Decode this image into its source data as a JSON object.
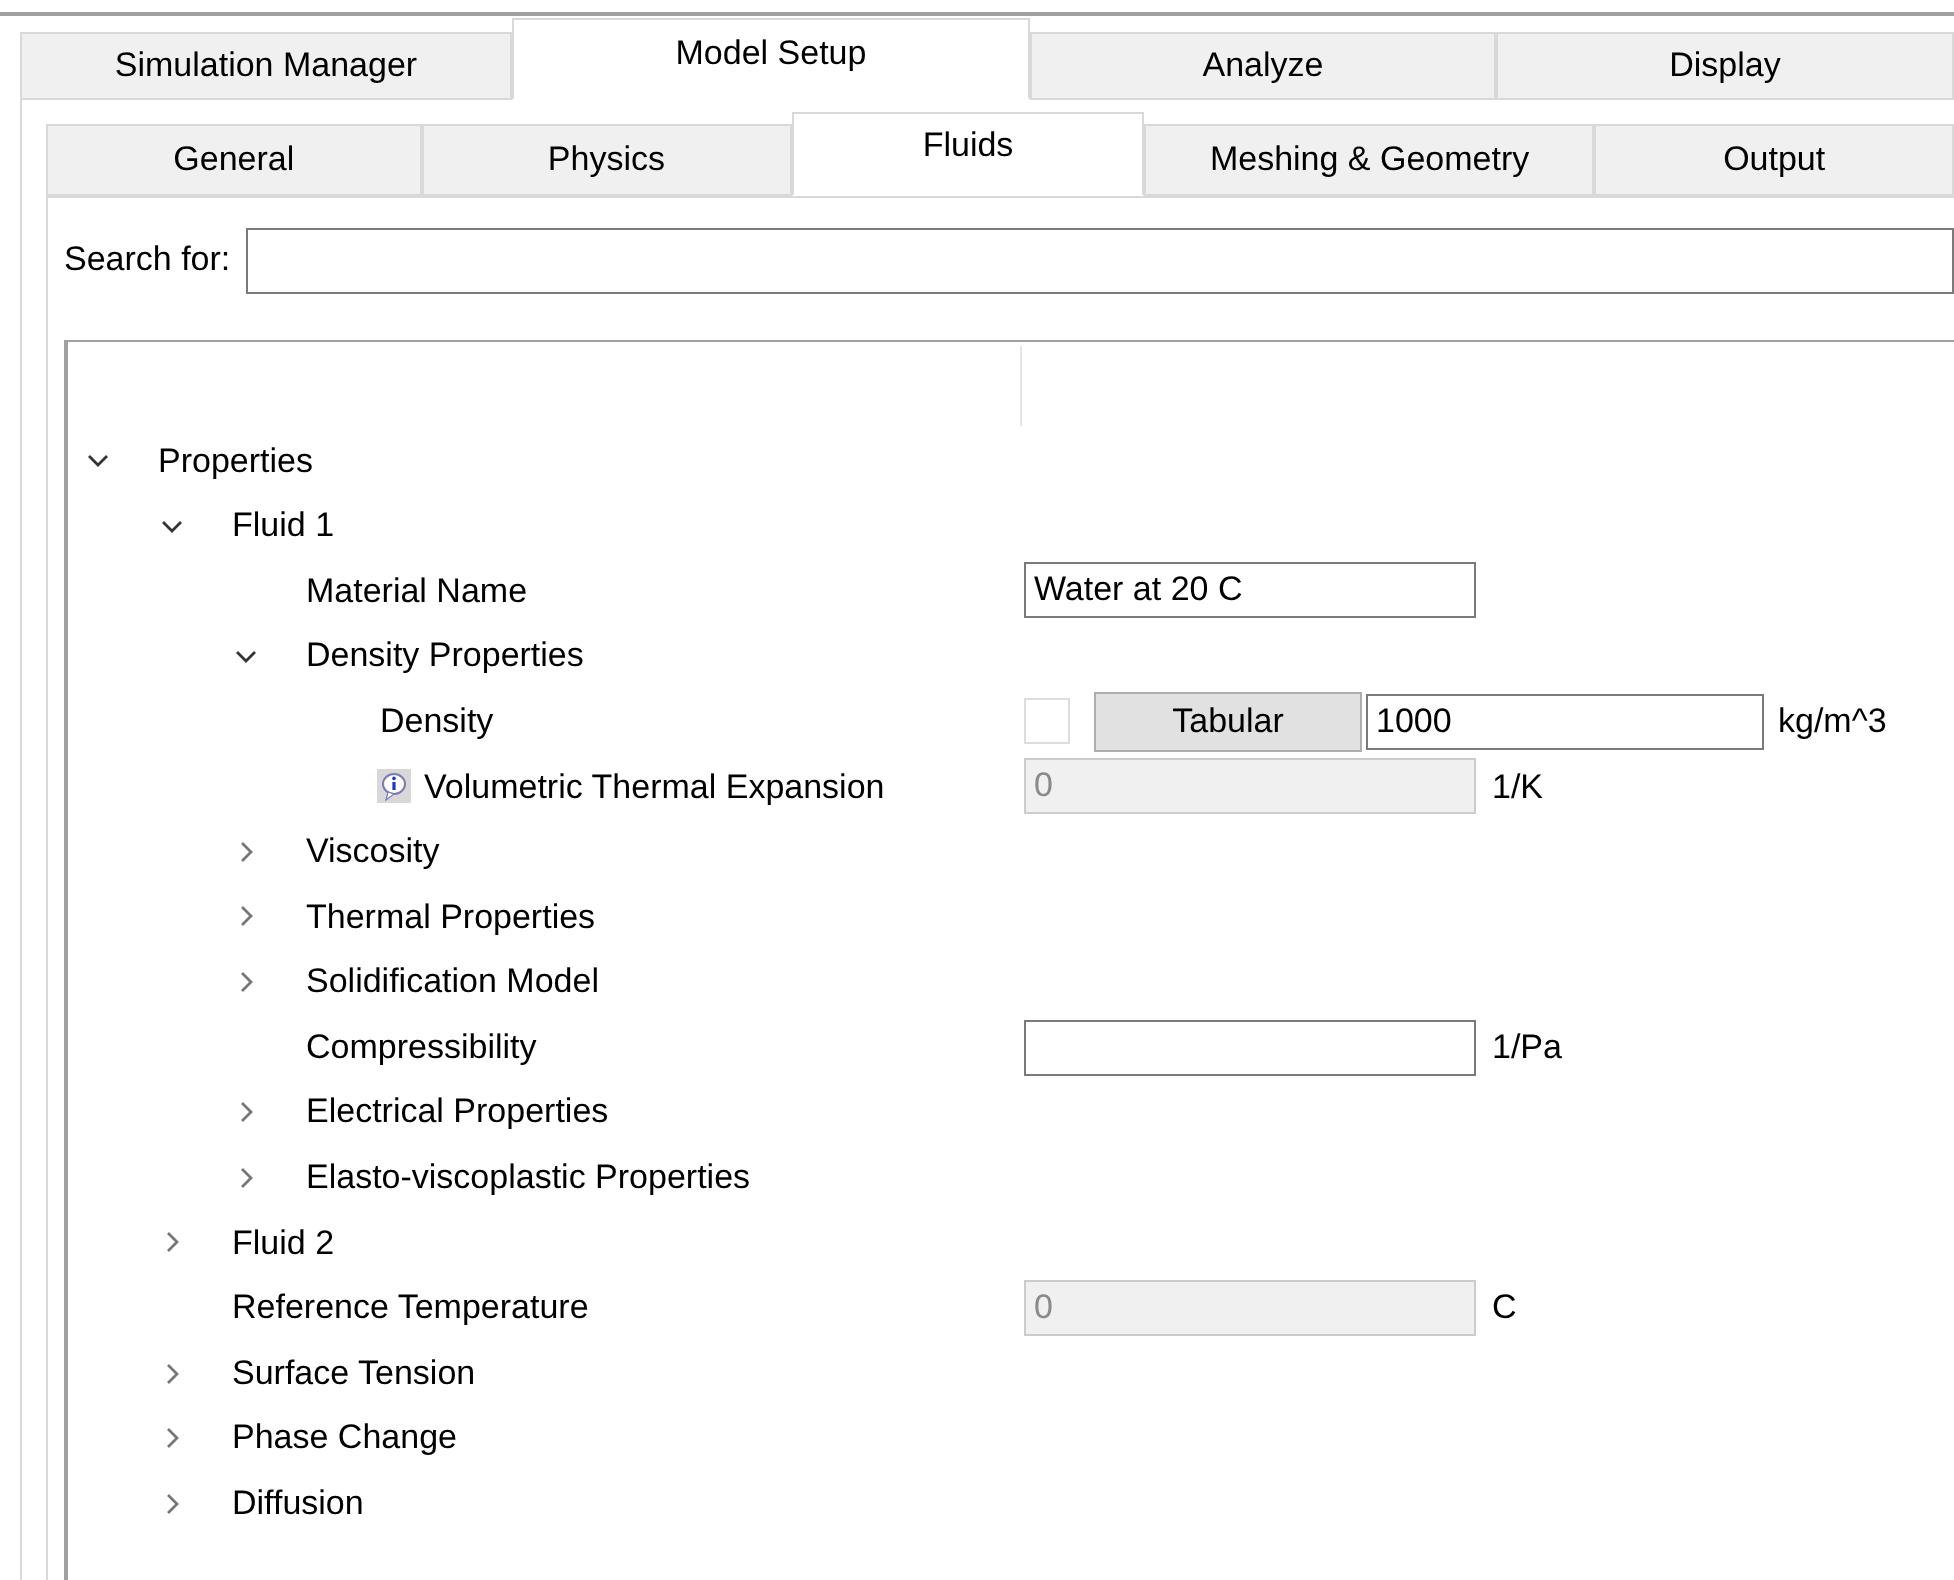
{
  "main_tabs": [
    {
      "label": "Simulation Manager",
      "selected": false
    },
    {
      "label": "Model Setup",
      "selected": true
    },
    {
      "label": "Analyze",
      "selected": false
    },
    {
      "label": "Display",
      "selected": false
    }
  ],
  "sub_tabs": [
    {
      "label": "General",
      "selected": false
    },
    {
      "label": "Physics",
      "selected": false
    },
    {
      "label": "Fluids",
      "selected": true
    },
    {
      "label": "Meshing & Geometry",
      "selected": false
    },
    {
      "label": "Output",
      "selected": false
    }
  ],
  "search": {
    "label": "Search for:"
  },
  "tree": [
    {
      "kind": "group",
      "label": "Properties",
      "expanded": true,
      "children": [
        {
          "kind": "group",
          "label": "Fluid 1",
          "expanded": true,
          "children": [
            {
              "kind": "field",
              "label": "Material Name",
              "value": "Water at 20 C",
              "disabled": false
            },
            {
              "kind": "group",
              "label": "Density Properties",
              "expanded": true,
              "children": [
                {
                  "kind": "tabular",
                  "label": "Density",
                  "checked": false,
                  "button": "Tabular",
                  "value": "1000",
                  "unit": "kg/m^3"
                },
                {
                  "kind": "infofield",
                  "label": "Volumetric Thermal Expansion",
                  "value": "0",
                  "unit": "1/K",
                  "disabled": true
                }
              ]
            },
            {
              "kind": "group",
              "label": "Viscosity",
              "expanded": false
            },
            {
              "kind": "group",
              "label": "Thermal Properties",
              "expanded": false
            },
            {
              "kind": "group",
              "label": "Solidification Model",
              "expanded": false
            },
            {
              "kind": "field",
              "label": "Compressibility",
              "unit": "1/Pa",
              "disabled": false
            },
            {
              "kind": "group",
              "label": "Electrical Properties",
              "expanded": false
            },
            {
              "kind": "group",
              "label": "Elasto-viscoplastic Properties",
              "expanded": false
            }
          ]
        },
        {
          "kind": "group",
          "label": "Fluid 2",
          "expanded": false
        },
        {
          "kind": "field",
          "label": "Reference Temperature",
          "value": "0",
          "unit": "C",
          "disabled": true
        },
        {
          "kind": "group",
          "label": "Surface Tension",
          "expanded": false
        },
        {
          "kind": "group",
          "label": "Phase Change",
          "expanded": false
        },
        {
          "kind": "group",
          "label": "Diffusion",
          "expanded": false
        }
      ]
    }
  ]
}
